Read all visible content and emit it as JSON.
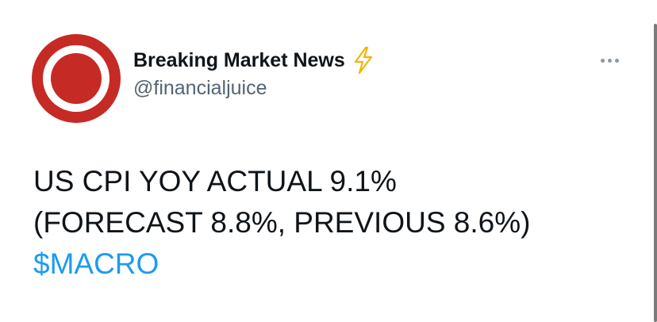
{
  "header": {
    "display_name": "Breaking Market News",
    "badge_icon": "lightning-bolt-icon",
    "handle": "@financialjuice",
    "more_icon": "more-options-icon",
    "avatar_colors": {
      "outer": "#c62a25",
      "ring": "#ffffff"
    }
  },
  "tweet": {
    "line1": "US CPI YOY ACTUAL 9.1%",
    "line2": "(FORECAST 8.8%, PREVIOUS 8.6%)",
    "cashtag": "$MACRO"
  },
  "colors": {
    "text": "#0f1419",
    "secondary": "#536471",
    "link": "#1d9bf0",
    "bolt": "#f5b400"
  }
}
